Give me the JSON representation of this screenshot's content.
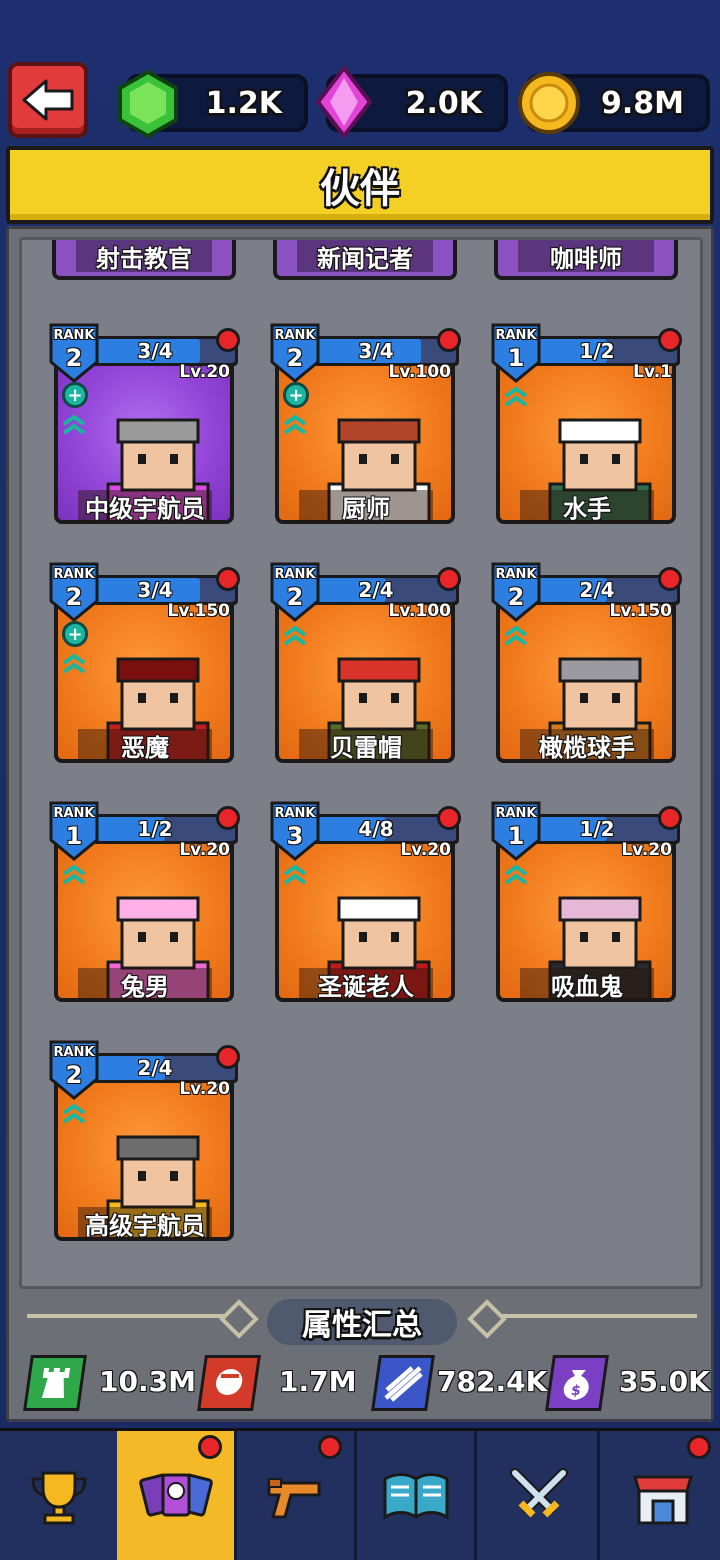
{
  "currencies": [
    {
      "icon": "green-gem-icon",
      "value": "1.2K"
    },
    {
      "icon": "pink-crystal-icon",
      "value": "2.0K"
    },
    {
      "icon": "gold-coin-icon",
      "value": "9.8M"
    }
  ],
  "title": "伙伴",
  "top_row": [
    "射击教官",
    "新闻记者",
    "咖啡师"
  ],
  "cards": [
    {
      "name": "中级宇航员",
      "rank_label": "RANK",
      "rank": "2",
      "progress": "3/4",
      "progress_frac": 0.75,
      "level": "Lv.20",
      "plus": true,
      "theme": "purple"
    },
    {
      "name": "厨师",
      "rank_label": "RANK",
      "rank": "2",
      "progress": "3/4",
      "progress_frac": 0.75,
      "level": "Lv.100",
      "plus": true,
      "theme": "orange"
    },
    {
      "name": "水手",
      "rank_label": "RANK",
      "rank": "1",
      "progress": "1/2",
      "progress_frac": 0.5,
      "level": "Lv.1",
      "plus": false,
      "theme": "orange"
    },
    {
      "name": "恶魔",
      "rank_label": "RANK",
      "rank": "2",
      "progress": "3/4",
      "progress_frac": 0.75,
      "level": "Lv.150",
      "plus": true,
      "theme": "orange"
    },
    {
      "name": "贝雷帽",
      "rank_label": "RANK",
      "rank": "2",
      "progress": "2/4",
      "progress_frac": 0.5,
      "level": "Lv.100",
      "plus": false,
      "theme": "orange"
    },
    {
      "name": "橄榄球手",
      "rank_label": "RANK",
      "rank": "2",
      "progress": "2/4",
      "progress_frac": 0.5,
      "level": "Lv.150",
      "plus": false,
      "theme": "orange"
    },
    {
      "name": "兔男",
      "rank_label": "RANK",
      "rank": "1",
      "progress": "1/2",
      "progress_frac": 0.5,
      "level": "Lv.20",
      "plus": false,
      "theme": "orange"
    },
    {
      "name": "圣诞老人",
      "rank_label": "RANK",
      "rank": "3",
      "progress": "4/8",
      "progress_frac": 0.5,
      "level": "Lv.20",
      "plus": false,
      "theme": "orange"
    },
    {
      "name": "吸血鬼",
      "rank_label": "RANK",
      "rank": "1",
      "progress": "1/2",
      "progress_frac": 0.5,
      "level": "Lv.20",
      "plus": false,
      "theme": "orange"
    },
    {
      "name": "高级宇航员",
      "rank_label": "RANK",
      "rank": "2",
      "progress": "2/4",
      "progress_frac": 0.5,
      "level": "Lv.20",
      "plus": false,
      "theme": "orange"
    }
  ],
  "summary": {
    "title": "属性汇总",
    "stats": [
      {
        "icon": "tower-icon",
        "value": "10.3M",
        "color": "#2fa84a"
      },
      {
        "icon": "fist-icon",
        "value": "1.7M",
        "color": "#d23a2a"
      },
      {
        "icon": "claw-icon",
        "value": "782.4K",
        "color": "#3a56c8"
      },
      {
        "icon": "money-bag-icon",
        "value": "35.0K",
        "color": "#7b3fc4"
      }
    ]
  },
  "nav": [
    {
      "icon": "trophy-icon",
      "active": false,
      "dot": false
    },
    {
      "icon": "partner-cards-icon",
      "active": true,
      "dot": true
    },
    {
      "icon": "pistol-icon",
      "active": false,
      "dot": true
    },
    {
      "icon": "book-icon",
      "active": false,
      "dot": false
    },
    {
      "icon": "crossed-swords-icon",
      "active": false,
      "dot": false
    },
    {
      "icon": "shop-icon",
      "active": false,
      "dot": true
    }
  ]
}
